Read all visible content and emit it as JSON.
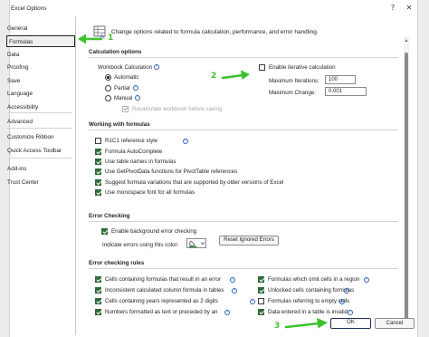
{
  "window": {
    "title": "Excel Options",
    "help_glyph": "?",
    "close_glyph": "✕"
  },
  "sidebar": {
    "items": [
      {
        "label": "General"
      },
      {
        "label": "Formulas"
      },
      {
        "label": "Data"
      },
      {
        "label": "Proofing"
      },
      {
        "label": "Save"
      },
      {
        "label": "Language"
      },
      {
        "label": "Accessibility"
      },
      {
        "label": "Advanced"
      },
      {
        "label": "Customize Ribbon"
      },
      {
        "label": "Quick Access Toolbar"
      },
      {
        "label": "Add-ins"
      },
      {
        "label": "Trust Center"
      }
    ],
    "selected": "Formulas"
  },
  "header": {
    "description": "Change options related to formula calculation, performance, and error handling."
  },
  "calculation_options": {
    "heading": "Calculation options",
    "workbook_calc_label": "Workbook Calculation",
    "radios": [
      {
        "label": "Automatic",
        "checked": true
      },
      {
        "label": "Partial",
        "checked": false
      },
      {
        "label": "Manual",
        "checked": false
      }
    ],
    "recalc_before_save": {
      "label": "Recalculate workbook before saving",
      "checked": true,
      "disabled": true
    },
    "enable_iterative": {
      "label": "Enable iterative calculation",
      "checked": false
    },
    "max_iterations": {
      "label": "Maximum Iterations:",
      "value": "100"
    },
    "max_change": {
      "label": "Maximum Change:",
      "value": "0.001"
    }
  },
  "working_with_formulas": {
    "heading": "Working with formulas",
    "items": [
      {
        "label": "R1C1 reference style",
        "checked": false
      },
      {
        "label": "Formula AutoComplete",
        "checked": true
      },
      {
        "label": "Use table names in formulas",
        "checked": true
      },
      {
        "label": "Use GetPivotData functions for PivotTable references",
        "checked": true
      },
      {
        "label": "Suggest formula variations that are supported by older versions of Excel",
        "checked": true
      },
      {
        "label": "Use monospace font for all formulas",
        "checked": true
      }
    ]
  },
  "error_checking": {
    "heading": "Error Checking",
    "enable_background": {
      "label": "Enable background error checking",
      "checked": true
    },
    "indicate_color_label": "Indicate errors using this color:",
    "reset_button": "Reset Ignored Errors"
  },
  "error_checking_rules": {
    "heading": "Error checking rules",
    "left": [
      {
        "label": "Cells containing formulas that result in an error",
        "checked": true
      },
      {
        "label": "Inconsistent calculated column formula in tables",
        "checked": true
      },
      {
        "label": "Cells containing years represented as 2 digits",
        "checked": true
      },
      {
        "label": "Numbers formatted as text or preceded by an",
        "checked": true
      }
    ],
    "right": [
      {
        "label": "Formulas which omit cells in a region",
        "checked": true
      },
      {
        "label": "Unlocked cells containing formulas",
        "checked": true
      },
      {
        "label": "Formulas referring to empty cells",
        "checked": false
      },
      {
        "label": "Data entered in a table is invalid",
        "checked": true
      }
    ]
  },
  "footer": {
    "ok": "OK",
    "cancel": "Cancel"
  },
  "annotations": {
    "step1": "1",
    "step2": "2",
    "step3": "3",
    "color": "#3ec12f"
  },
  "colors": {
    "accent_check": "#2f6b39",
    "info_blue": "#2d63b8"
  }
}
